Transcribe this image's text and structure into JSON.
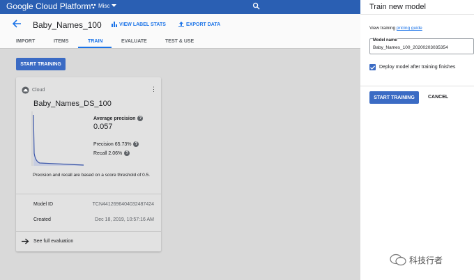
{
  "topbar": {
    "brand": "Google Cloud Platform",
    "project": "Misc"
  },
  "header": {
    "dataset_name": "Baby_Names_100",
    "view_label_stats": "VIEW LABEL STATS",
    "export_data": "EXPORT DATA"
  },
  "tabs": [
    {
      "label": "IMPORT"
    },
    {
      "label": "ITEMS"
    },
    {
      "label": "TRAIN"
    },
    {
      "label": "EVALUATE"
    },
    {
      "label": "TEST & USE"
    }
  ],
  "main": {
    "start_training": "START TRAINING",
    "card": {
      "source": "Cloud",
      "model_name": "Baby_Names_DS_100",
      "avg_precision_label": "Average precision",
      "avg_precision_value": "0.057",
      "precision_text": "Precision 65.73%",
      "recall_text": "Recall 2.06%",
      "note": "Precision and recall are based on a score threshold of 0.5.",
      "model_id_label": "Model ID",
      "model_id_value": "TCN4412696404032487424",
      "created_label": "Created",
      "created_value": "Dec 18, 2019, 10:57:16 AM",
      "see_full": "See full evaluation"
    }
  },
  "panel": {
    "title": "Train new model",
    "pricing_prefix": "View training",
    "pricing_link": "pricing guide",
    "field_label": "Model name",
    "field_value": "Baby_Names_100_20200203035354",
    "deploy_label": "Deploy model after training finishes",
    "deploy_checked": true,
    "start_training": "START TRAINING",
    "cancel": "CANCEL"
  },
  "watermark": "科技行者",
  "colors": {
    "topbar": "#2a5fb3",
    "accent": "#1a73e8",
    "button": "#3b6bc4"
  }
}
